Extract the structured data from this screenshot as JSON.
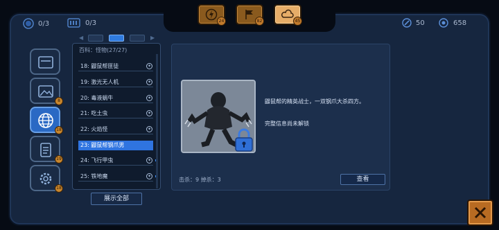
{
  "stats": {
    "kills_progress": "0/3",
    "inventory_progress": "0/3",
    "crystals": "50",
    "coins": "658"
  },
  "top_tabs": [
    {
      "icon": "lightning-icon",
      "count": "24",
      "active": false
    },
    {
      "icon": "flag-icon",
      "count": "82",
      "active": false
    },
    {
      "icon": "cloud-icon",
      "count": "45",
      "active": true
    }
  ],
  "side_nav": [
    {
      "icon": "folder-icon",
      "badge": ""
    },
    {
      "icon": "picture-icon",
      "badge": "8"
    },
    {
      "icon": "globe-icon",
      "badge": "18",
      "active": true
    },
    {
      "icon": "clipboard-icon",
      "badge": "19"
    },
    {
      "icon": "gear-icon",
      "badge": "18"
    }
  ],
  "list": {
    "title": "百科：怪物(27/27)",
    "items": [
      {
        "label": "18: 鼹鼠帮匪徒",
        "state": "✦"
      },
      {
        "label": "19: 激光无人机",
        "state": "✦"
      },
      {
        "label": "20: 毒液蜗牛",
        "state": "✦"
      },
      {
        "label": "21: 吃土虫",
        "state": "✦"
      },
      {
        "label": "22: 火焰怪",
        "state": "✦"
      },
      {
        "label": "23: 鼹鼠帮钢爪男",
        "state": "",
        "selected": true
      },
      {
        "label": "24: 飞行甲虫",
        "state": "✦",
        "new": true
      },
      {
        "label": "25: 铁地魔",
        "state": "✦",
        "new": true
      }
    ],
    "show_all": "展示全部"
  },
  "detail": {
    "description": "鼹鼠帮的精英战士，一双钢爪大杀四方。",
    "locked_info": "完整信息尚未解锁",
    "kills": "击杀：9 掉杀：3",
    "view_button": "查看"
  },
  "colors": {
    "accent": "#2f74e0",
    "orange": "#b86b22",
    "panel": "#16263f"
  }
}
